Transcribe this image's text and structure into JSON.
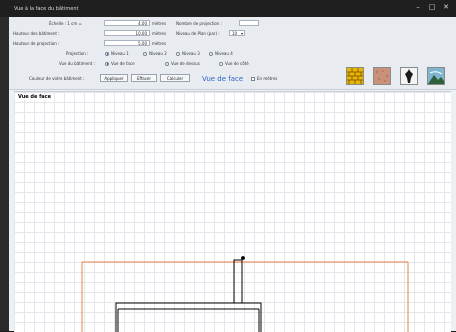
{
  "window": {
    "title": "Vue à la face du bâtiment",
    "buttons": {
      "minimize": "–",
      "maximize": "□",
      "close": "✕"
    }
  },
  "form": {
    "echelle": {
      "label": "Échelle : 1 cm =",
      "value": "4.00",
      "unit": "mètres"
    },
    "hauteur_batiment": {
      "label": "Hauteur des bâtiment :",
      "value": "10.00",
      "unit": "mètres"
    },
    "hauteur_projection": {
      "label": "Hauteur de projection :",
      "value": "5.00",
      "unit": "mètres"
    },
    "nombre_projection": {
      "label": "Nombre de projection :",
      "value": ""
    },
    "niveau_vue": {
      "label": "Niveau de Plan (par) :",
      "value": "10"
    },
    "projection": {
      "label": "Projection :",
      "options": [
        "Niveau 1",
        "Niveau 2",
        "Niveau 3",
        "Niveau 4"
      ],
      "selected": 0
    },
    "vue_batiment": {
      "label": "Vue du bâtiment :",
      "options": [
        "Vue de face",
        "Vue de dessus",
        "Vue de côté"
      ],
      "selected": 0
    },
    "couleur_label": "Couleur de votre bâtiment :",
    "buttons": [
      "Appliquer",
      "Effacer",
      "Calculer"
    ],
    "view_title": "Vue de face",
    "checkbox_label": "En mètres"
  },
  "textures": [
    "brick-texture-icon",
    "stone-texture-icon",
    "vase-icon",
    "landscape-icon"
  ],
  "colors": {
    "outline": "#e8834a",
    "building": "#000000",
    "accent": "#2a63c4"
  },
  "drawing": {
    "label": "Vue de face"
  }
}
